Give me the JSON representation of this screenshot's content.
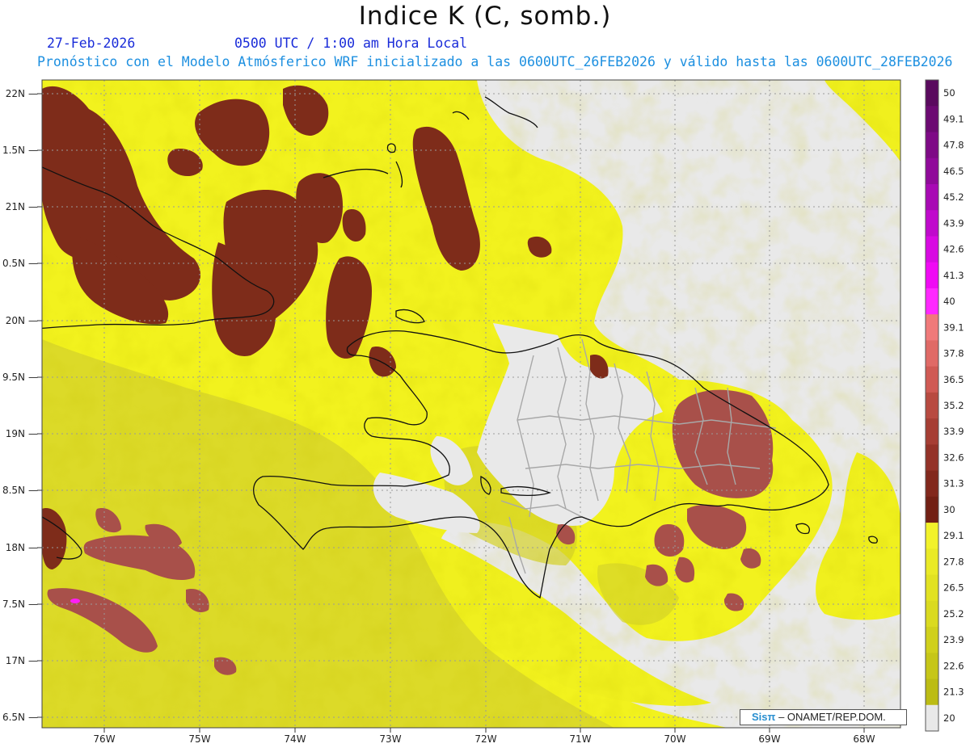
{
  "header": {
    "title": "Indice K (C, somb.)",
    "date": "27-Feb-2026",
    "valid_time": "0500 UTC / 1:00 am Hora Local",
    "model_info": "Pronóstico con el Modelo Atmósferico WRF inicializado a las 0600UTC_26FEB2026 y válido hasta las  0600UTC_28FEB2026"
  },
  "axes": {
    "lon_labels": [
      "76W",
      "75W",
      "74W",
      "73W",
      "72W",
      "71W",
      "70W",
      "69W",
      "68W"
    ],
    "lat_labels": [
      "22N",
      "1.5N",
      "21N",
      "0.5N",
      "20N",
      "9.5N",
      "19N",
      "8.5N",
      "18N",
      "7.5N",
      "17N",
      "6.5N"
    ]
  },
  "colorbar": {
    "labels": [
      "50",
      "49.1",
      "47.8",
      "46.5",
      "45.2",
      "43.9",
      "42.6",
      "41.3",
      "40",
      "39.1",
      "37.8",
      "36.5",
      "35.2",
      "33.9",
      "32.6",
      "31.3",
      "30",
      "29.1",
      "27.8",
      "26.5",
      "25.2",
      "23.9",
      "22.6",
      "21.3",
      "20"
    ],
    "colors": [
      "#5a0a5e",
      "#6c0a72",
      "#7e0a86",
      "#900a9a",
      "#a80ab4",
      "#c00acc",
      "#d80ae2",
      "#f00af4",
      "#ff28ff",
      "#f07a7a",
      "#e06a66",
      "#d05a54",
      "#b84a40",
      "#a63e34",
      "#943228",
      "#82281c",
      "#722014",
      "#f2f22a",
      "#eaea26",
      "#e2e222",
      "#dada20",
      "#d0d01c",
      "#c6c618",
      "#bcbc14",
      "#e8e8e8"
    ],
    "palette": {
      "yellow": "#f2f21e",
      "olive": "#d8d62a",
      "brown": "#7e2c1a",
      "mauve": "#a8504a",
      "magenta": "#ff1ff5",
      "nodata": "#e9e9e9"
    }
  },
  "credit": {
    "brand": "Sisπ",
    "org": "– ONAMET/REP.DOM."
  }
}
